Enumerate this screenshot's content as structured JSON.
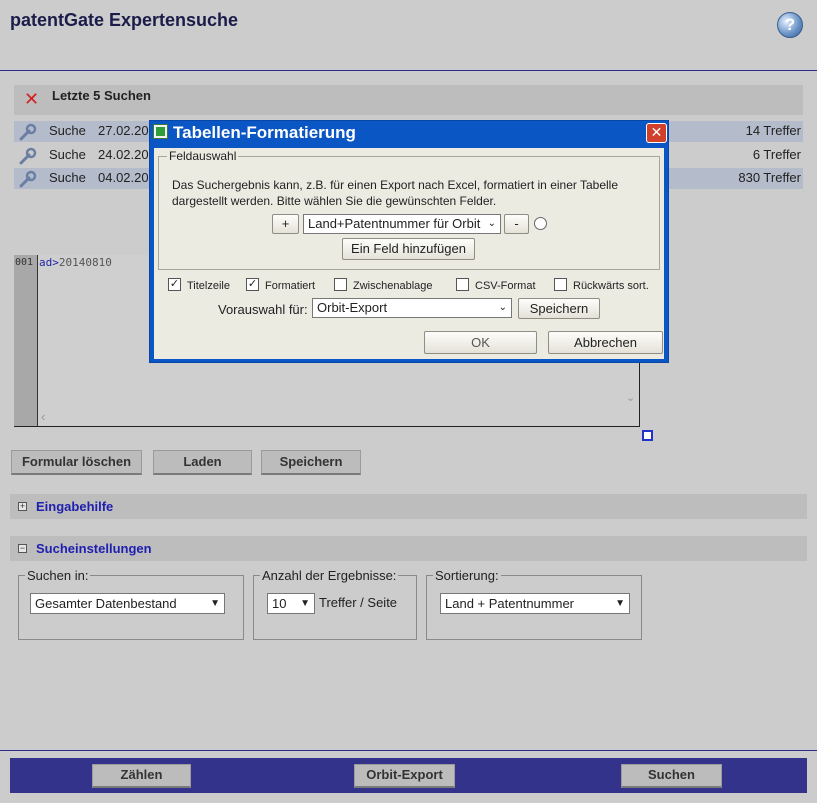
{
  "app": {
    "title": "patentGate Expertensuche",
    "help_icon": "question-icon"
  },
  "recent": {
    "title": "Letzte 5 Suchen",
    "rows": [
      {
        "type": "Suche",
        "date": "27.02.20",
        "count": "14 Treffer"
      },
      {
        "type": "Suche",
        "date": "24.02.20",
        "count": "6 Treffer"
      },
      {
        "type": "Suche",
        "date": "04.02.20",
        "count": "830 Treffer"
      }
    ]
  },
  "editor": {
    "line_number": "001",
    "keyword": "ad>",
    "value": "20140810"
  },
  "form_buttons": {
    "clear": "Formular löschen",
    "load": "Laden",
    "save": "Speichern"
  },
  "sections": {
    "help": {
      "label": "Eingabehilfe",
      "toggle": "+"
    },
    "settings": {
      "label": "Sucheinstellungen",
      "toggle": "−"
    }
  },
  "settings": {
    "search_in": {
      "legend": "Suchen in:",
      "value": "Gesamter Datenbestand"
    },
    "results": {
      "legend": "Anzahl der Ergebnisse:",
      "value": "10",
      "suffix": "Treffer / Seite"
    },
    "sort": {
      "legend": "Sortierung:",
      "value": "Land + Patentnummer"
    }
  },
  "footer": {
    "count": "Zählen",
    "export": "Orbit-Export",
    "search": "Suchen"
  },
  "dialog": {
    "title": "Tabellen-Formatierung",
    "close": "✕",
    "fieldset": {
      "legend": "Feldauswahl",
      "description": "Das Suchergebnis kann, z.B. für einen Export nach Excel, formatiert in einer Tabelle dargestellt werden. Bitte wählen Sie die gewünschten Felder.",
      "plus": "+",
      "field_value": "Land+Patentnummer für Orbit",
      "minus": "-",
      "add_field": "Ein Feld hinzufügen"
    },
    "options": [
      {
        "label": "Titelzeile",
        "checked": true
      },
      {
        "label": "Formatiert",
        "checked": true
      },
      {
        "label": "Zwischenablage",
        "checked": false
      },
      {
        "label": "CSV-Format",
        "checked": false
      },
      {
        "label": "Rückwärts sort.",
        "checked": false
      }
    ],
    "preset": {
      "label": "Vorauswahl für:",
      "value": "Orbit-Export",
      "save": "Speichern"
    },
    "ok": "OK",
    "cancel": "Abbrechen"
  }
}
